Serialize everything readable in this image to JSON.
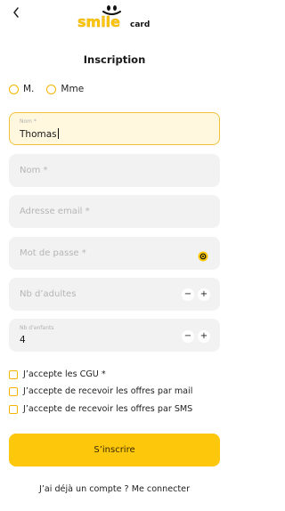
{
  "header": {
    "back_icon": "chevron-left-icon",
    "logo": {
      "word": "smile",
      "suffix": "card",
      "color": "#fdc70c"
    }
  },
  "page": {
    "title": "Inscription"
  },
  "civility": {
    "options": [
      {
        "label": "M."
      },
      {
        "label": "Mme"
      }
    ],
    "accent": "#f4b400"
  },
  "form": {
    "prenom": {
      "label": "Nom *",
      "value": "Thomas"
    },
    "nom": {
      "placeholder": "Nom *"
    },
    "email": {
      "placeholder": "Adresse email *"
    },
    "password": {
      "placeholder": "Mot de passe *",
      "icon": "eye-icon"
    },
    "adults": {
      "placeholder": "Nb d’adultes",
      "minus": "−",
      "plus": "+"
    },
    "children": {
      "label": "Nb d’enfants",
      "value": "4",
      "minus": "−",
      "plus": "+"
    }
  },
  "checkboxes": [
    {
      "label": "J’accepte les CGU *"
    },
    {
      "label": "J’accepte de recevoir les offres par mail"
    },
    {
      "label": "J’accepte de recevoir les offres par SMS"
    }
  ],
  "submit": {
    "label": "S’inscrire",
    "color": "#fdc70c"
  },
  "footer": {
    "text": "J’ai déjà un compte ? Me connecter"
  }
}
